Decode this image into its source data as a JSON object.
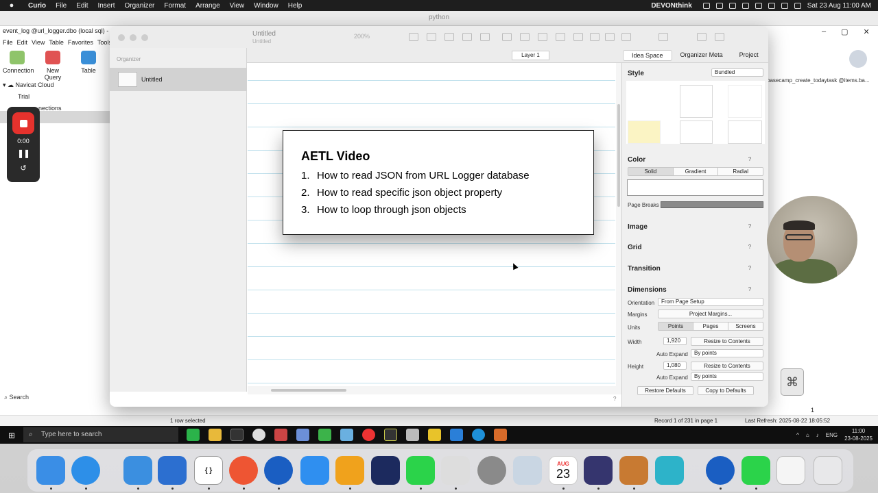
{
  "menubar": {
    "apple": "",
    "items": [
      "Curio",
      "File",
      "Edit",
      "Insert",
      "Organizer",
      "Format",
      "Arrange",
      "View",
      "Window",
      "Help"
    ],
    "devonthink": "DEVONthink",
    "datetime": "Sat 23 Aug  11:00 AM"
  },
  "curio": {
    "window_title": "python",
    "doc_title": "Untitled",
    "doc_subtitle": "Untitled",
    "zoom": "200%",
    "layer": "Layer 1",
    "tabs": [
      "Idea Space",
      "Organizer Meta",
      "Project"
    ],
    "organizer_header": "Organizer",
    "organizer_item": "Untitled",
    "card": {
      "title": "AETL Video",
      "items": [
        {
          "num": "1.",
          "text": "How to read JSON from URL Logger database"
        },
        {
          "num": "2.",
          "text": "How to read specific json object property"
        },
        {
          "num": "3.",
          "text": "How to loop through json objects"
        }
      ]
    },
    "inspector": {
      "style_label": "Style",
      "style_value": "Bundled",
      "color_label": "Color",
      "color_modes": [
        "Solid",
        "Gradient",
        "Radial"
      ],
      "page_breaks": "Page Breaks",
      "image": "Image",
      "grid": "Grid",
      "transition": "Transition",
      "dimensions": "Dimensions",
      "orientation_label": "Orientation",
      "orientation_value": "From Page Setup",
      "margins_label": "Margins",
      "margins_button": "Project Margins...",
      "units_label": "Units",
      "units": [
        "Points",
        "Pages",
        "Screens"
      ],
      "width_label": "Width",
      "width_value": "1,920",
      "resize": "Resize to Contents",
      "auto_expand": "Auto Expand",
      "by_points": "By points",
      "height_label": "Height",
      "height_value": "1,080",
      "restore": "Restore Defaults",
      "copy": "Copy to Defaults",
      "help": "?"
    }
  },
  "navicat": {
    "file": "event_log @url_logger.dbo (local sql) - T",
    "menu": [
      "File",
      "Edit",
      "View",
      "Table",
      "Favorites",
      "Tools"
    ],
    "tools": [
      "Connection",
      "New Query",
      "Table"
    ],
    "tree": [
      "Navicat Cloud",
      "Trial",
      "nections"
    ],
    "search": "Search",
    "tab": "basecamp_create_todaytask @items.ba...",
    "rows_selected": "1 row selected",
    "record": "Record 1 of 231 in page 1",
    "refresh": "Last Refresh: 2025-08-22 18:05:52",
    "page": "1"
  },
  "recorder": {
    "time": "0:00"
  },
  "taskbar": {
    "search_placeholder": "Type here to search",
    "lang": "ENG",
    "time": "11:00",
    "date": "23-08-2025"
  },
  "dock": {
    "calendar_month": "AUG",
    "calendar_day": "23"
  }
}
